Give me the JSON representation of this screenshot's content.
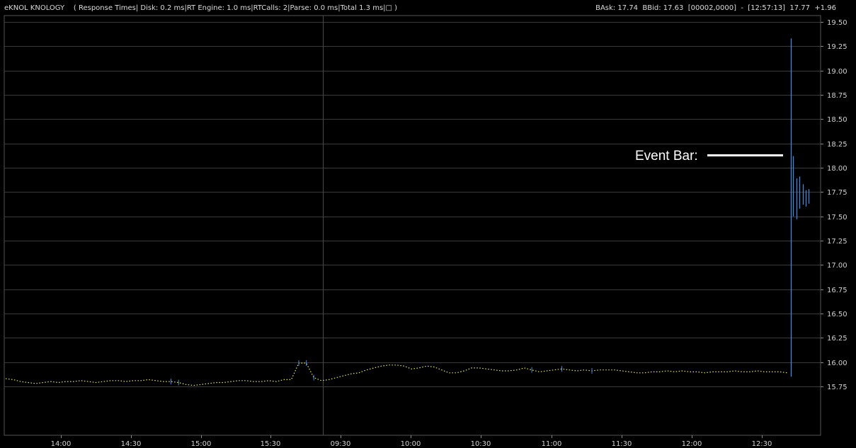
{
  "header": {
    "symbol": "eKNOL KNOLOGY",
    "response_times": "( Response Times| Disk: 0.2 ms|RT Engine: 1.0 ms|RTCalls: 2|Parse: 0.0 ms|Total 1.3 ms|□ )",
    "quote": "BAsk: 17.74  BBid: 17.63  [00002,0000]  -  [12:57:13]  17.77  +1.96"
  },
  "chart_data": {
    "type": "line",
    "title": "",
    "xlabel": "",
    "ylabel": "",
    "ylim": [
      15.625,
      19.55
    ],
    "grid": true,
    "y_ticks": [
      "19.50",
      "19.25",
      "19.00",
      "18.75",
      "18.50",
      "18.25",
      "18.00",
      "17.75",
      "17.50",
      "17.25",
      "17.00",
      "16.75",
      "16.50",
      "16.25",
      "16.00",
      "15.75"
    ],
    "x_ticks": [
      "14:00",
      "14:30",
      "15:00",
      "15:30",
      "09:30",
      "10:00",
      "10:30",
      "11:00",
      "11:30",
      "12:00",
      "12:30"
    ],
    "session_break_after": "15:30",
    "colors": {
      "line": "#e8e85a",
      "bar": "#4a86d8",
      "grid": "#3a3a3a",
      "background": "#000000"
    },
    "series": [
      {
        "values": [
          15.83,
          15.82,
          15.8,
          15.79,
          15.78,
          15.79,
          15.8,
          15.79,
          15.8,
          15.8,
          15.81,
          15.8,
          15.79,
          15.8,
          15.81,
          15.81,
          15.8,
          15.81,
          15.81,
          15.82,
          15.81,
          15.8,
          15.8,
          15.79,
          15.77,
          15.76,
          15.77,
          15.78,
          15.79,
          15.79,
          15.8,
          15.81,
          15.81,
          15.8,
          15.8,
          15.81,
          15.8,
          15.82,
          15.82,
          15.99,
          15.99,
          15.84,
          15.81,
          15.82,
          15.84,
          15.86,
          15.88,
          15.89,
          15.92,
          15.94,
          15.96,
          15.97,
          15.97,
          15.96,
          15.93,
          15.94,
          15.96,
          15.95,
          15.92,
          15.89,
          15.89,
          15.91,
          15.94,
          15.94,
          15.93,
          15.92,
          15.91,
          15.91,
          15.92,
          15.94,
          15.92,
          15.9,
          15.91,
          15.92,
          15.93,
          15.92,
          15.91,
          15.92,
          15.91,
          15.92,
          15.92,
          15.92,
          15.91,
          15.9,
          15.89,
          15.89,
          15.9,
          15.9,
          15.91,
          15.9,
          15.91,
          15.9,
          15.9,
          15.89,
          15.9,
          15.9,
          15.9,
          15.91,
          15.9,
          15.9,
          15.91,
          15.9,
          15.9,
          15.9,
          15.89
        ]
      }
    ],
    "event_bars": [
      {
        "high": 19.33,
        "low": 15.85
      },
      {
        "high": 18.12,
        "low": 17.5
      },
      {
        "high": 17.89,
        "low": 17.47
      },
      {
        "high": 17.91,
        "low": 17.58
      },
      {
        "high": 17.83,
        "low": 17.62
      },
      {
        "high": 17.77,
        "low": 17.6
      },
      {
        "high": 17.78,
        "low": 17.63
      }
    ],
    "annotation": "Event Bar:"
  }
}
